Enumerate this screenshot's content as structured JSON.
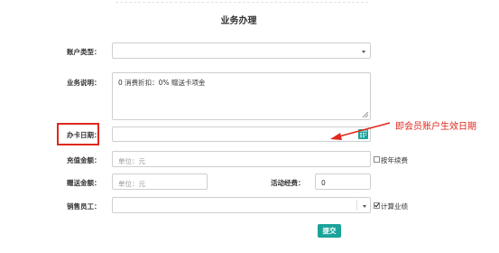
{
  "form": {
    "title": "业务办理",
    "account_type": {
      "label": "账户类型：",
      "value": ""
    },
    "description": {
      "label": "业务说明：",
      "value": "0  消费折扣：0%  赠送卡项金"
    },
    "card_date": {
      "label": "办卡日期：",
      "value": ""
    },
    "recharge": {
      "label": "充值金额：",
      "placeholder": "单位：元",
      "checkbox_label": "按年续费",
      "checked": false
    },
    "gift": {
      "label": "赠送金额：",
      "placeholder": "单位：元"
    },
    "activity_fee": {
      "label": "活动经费：",
      "value": "0"
    },
    "staff": {
      "label": "销售员工：",
      "value": "",
      "checkbox_label": "计算业绩",
      "checked": true
    },
    "submit_label": "提交"
  },
  "annotation": {
    "text": "即会员账户生效日期",
    "color": "#e0281e"
  },
  "colors": {
    "accent": "#1aa39a",
    "highlight": "#e0281e"
  }
}
